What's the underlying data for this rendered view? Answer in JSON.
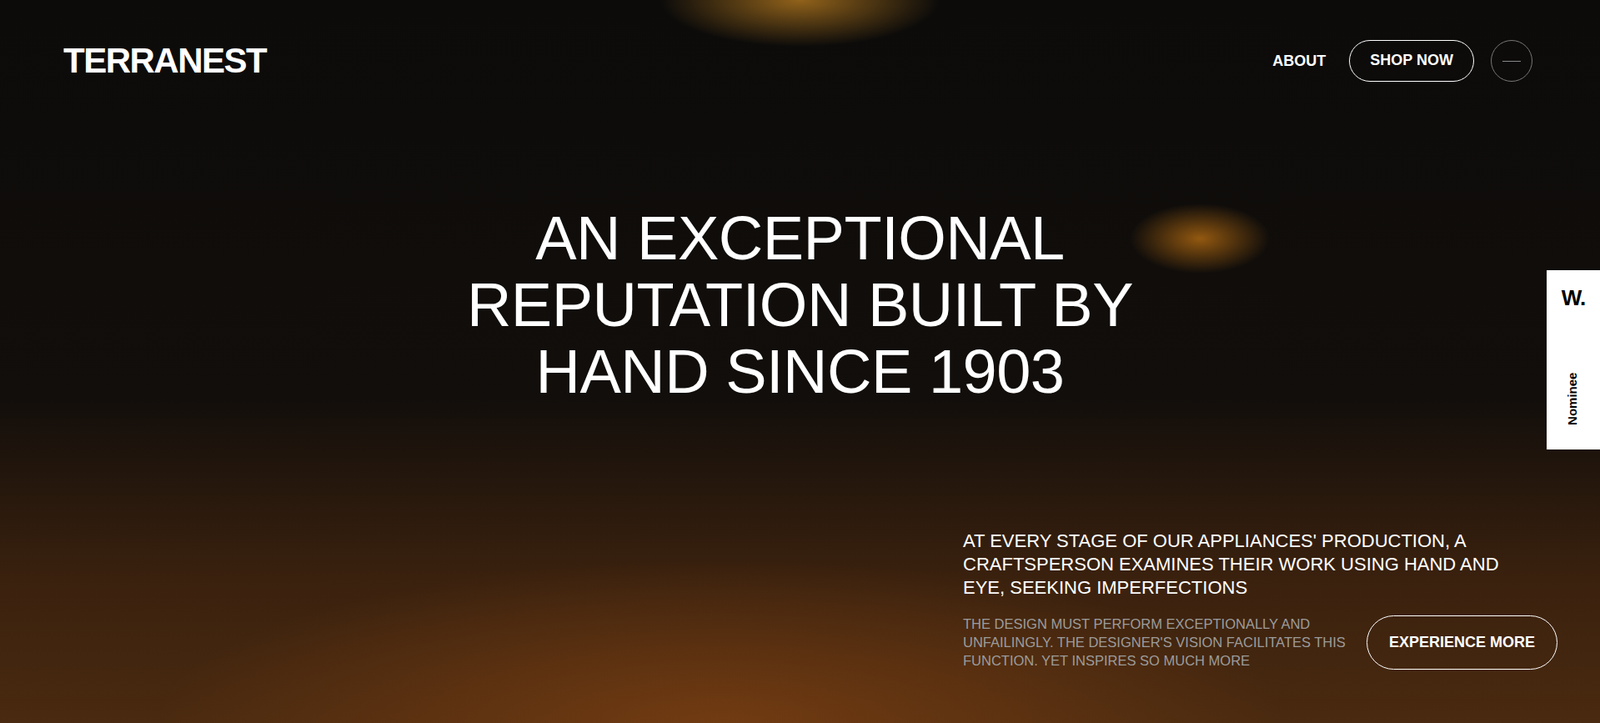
{
  "brand": {
    "logo": "TERRANEST"
  },
  "nav": {
    "links": [
      {
        "label": "ABOUT"
      }
    ],
    "cta": "SHOP NOW"
  },
  "hero": {
    "heading_lines": [
      "AN EXCEPTIONAL",
      "REPUTATION BUILT BY",
      "HAND SINCE 1903"
    ],
    "lead": "AT EVERY STAGE OF OUR APPLIANCES' PRODUCTION, A CRAFTSPERSON EXAMINES THEIR WORK USING HAND AND EYE, SEEKING IMPERFECTIONS",
    "body": "THE DESIGN MUST PERFORM EXCEPTIONALLY AND UNFAILINGLY. THE DESIGNER'S VISION FACILITATES THIS FUNCTION. YET INSPIRES SO MUCH MORE",
    "button": "EXPERIENCE MORE"
  },
  "award": {
    "mark": "W.",
    "label": "Nominee"
  }
}
